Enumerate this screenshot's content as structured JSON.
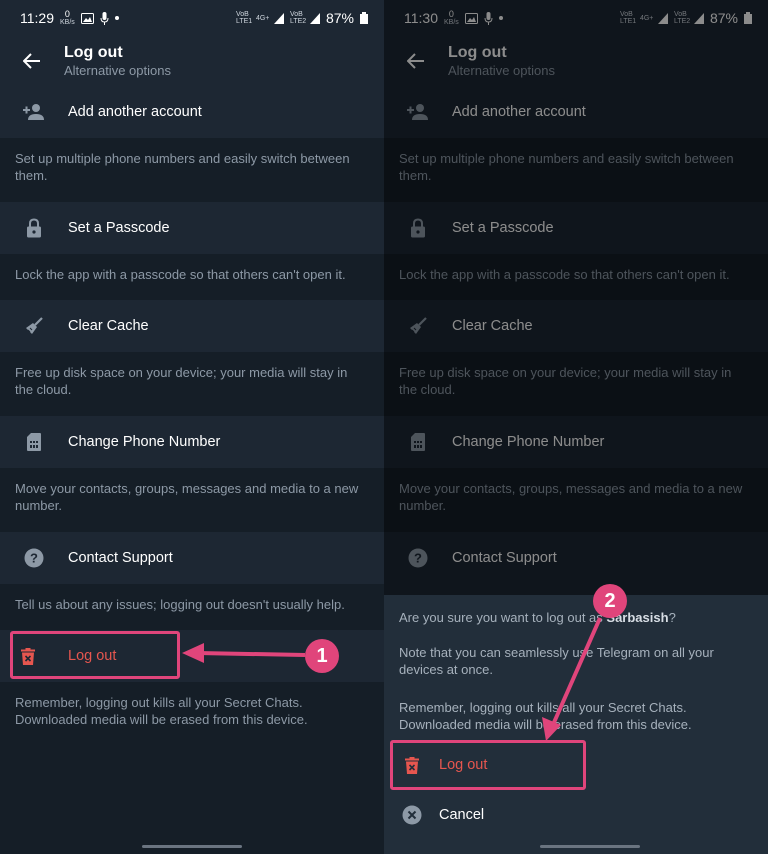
{
  "status_left": {
    "time": "11:29",
    "speed_value": "0",
    "speed_unit": "KB/s",
    "battery": "87%",
    "net1": "VoB LTE1",
    "net2": "4G+",
    "net3": "VoB LTE2"
  },
  "status_right": {
    "time": "11:30",
    "speed_value": "0",
    "speed_unit": "KB/s",
    "battery": "87%",
    "net1": "VoB LTE1",
    "net2": "4G+",
    "net3": "VoB LTE2"
  },
  "header": {
    "title": "Log out",
    "subtitle": "Alternative options"
  },
  "options": {
    "add_account": {
      "label": "Add another account",
      "info": "Set up multiple phone numbers and easily switch between them."
    },
    "passcode": {
      "label": "Set a Passcode",
      "info": "Lock the app with a passcode so that others can't open it."
    },
    "cache": {
      "label": "Clear Cache",
      "info": "Free up disk space on your device; your media will stay in the cloud."
    },
    "phone": {
      "label": "Change Phone Number",
      "info": "Move your contacts, groups, messages and media to a new number."
    },
    "support": {
      "label": "Contact Support",
      "info": "Tell us about any issues; logging out doesn't usually help."
    },
    "logout": {
      "label": "Log out",
      "info": "Remember, logging out kills all your Secret Chats. Downloaded media will be erased from this device."
    }
  },
  "sheet": {
    "q_prefix": "Are you sure you want to log out as ",
    "q_name": "Sarbasish",
    "q_suffix": "?",
    "note": "Note that you can seamlessly use Telegram on all your devices at once.",
    "remember": "Remember, logging out kills all your Secret Chats. Downloaded media will be erased from this device.",
    "logout_label": "Log out",
    "cancel_label": "Cancel"
  },
  "annotations": {
    "badge1": "1",
    "badge2": "2",
    "color": "#e0457b"
  },
  "colors": {
    "background": "#1d2733",
    "info_background": "#151e27",
    "danger": "#e6564f",
    "text_secondary": "#8d99a6"
  },
  "icons": [
    "back-arrow-icon",
    "add-user-icon",
    "lock-icon",
    "broom-icon",
    "sim-card-icon",
    "help-icon",
    "delete-icon",
    "close-circle-icon"
  ]
}
